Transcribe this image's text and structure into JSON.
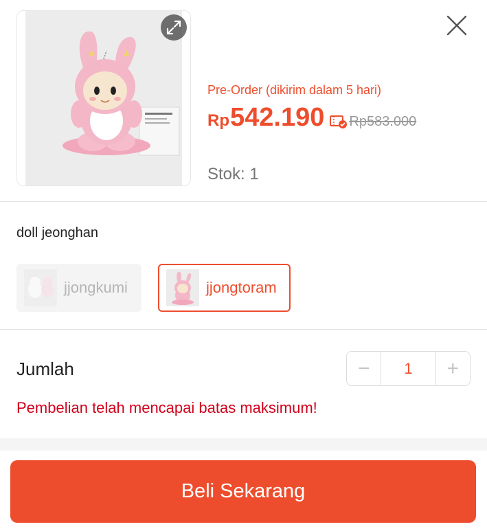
{
  "product": {
    "preorder_note": "Pre-Order (dikirim dalam 5 hari)",
    "price_currency": "Rp",
    "price_value": "542.190",
    "price_original": "Rp583.000",
    "stock": "Stok: 1",
    "image_icon": "expand-icon",
    "voucher_icon": "voucher-check-icon"
  },
  "header": {
    "close_icon": "close-icon"
  },
  "variation": {
    "title": "doll jeonghan",
    "options": [
      {
        "label": "jjongkumi",
        "state": "disabled"
      },
      {
        "label": "jjongtoram",
        "state": "selected"
      }
    ]
  },
  "quantity": {
    "label": "Jumlah",
    "value": "1",
    "minus": "−",
    "plus": "+",
    "limit_message": "Pembelian telah mencapai batas maksimum!"
  },
  "cta": {
    "buy_label": "Beli Sekarang"
  },
  "colors": {
    "accent": "#ee4d2d",
    "warning": "#d0011b",
    "muted": "#757575"
  }
}
